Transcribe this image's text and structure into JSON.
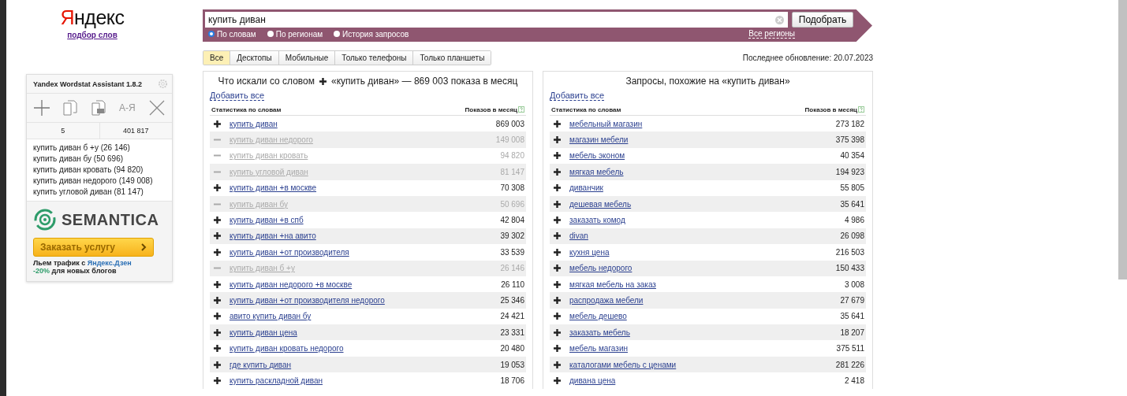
{
  "logo": {
    "text": "Яндекс",
    "subtitle": "подбор слов"
  },
  "search": {
    "value": "купить диван",
    "button": "Подобрать",
    "all_regions": "Все регионы",
    "modes": [
      {
        "label": "По словам",
        "selected": true
      },
      {
        "label": "По регионам",
        "selected": false
      },
      {
        "label": "История запросов",
        "selected": false
      }
    ]
  },
  "tabs": [
    {
      "label": "Все",
      "selected": true
    },
    {
      "label": "Десктопы",
      "selected": false
    },
    {
      "label": "Мобильные",
      "selected": false
    },
    {
      "label": "Только телефоны",
      "selected": false
    },
    {
      "label": "Только планшеты",
      "selected": false
    }
  ],
  "last_update": "Последнее обновление: 20.07.2023",
  "assistant": {
    "title": "Yandex Wordstat Assistant 1.8.2",
    "sort_label": "А-Я",
    "count": "5",
    "total": "401 817",
    "items": [
      "купить диван б +у (26 146)",
      "купить диван бу (50 696)",
      "купить диван кровать (94 820)",
      "купить диван недорого (149 008)",
      "купить угловой диван (81 147)"
    ],
    "ad": {
      "brand": "SEMANTICA",
      "button": "Заказать услугу",
      "line1": "Льем трафик с **Яндекс.Дзен**",
      "line2": "**-20%** для новых блогов"
    }
  },
  "panels": [
    {
      "title_pre": "Что искали со словом",
      "title_post": "«купить диван» — 869 003 показа в месяц",
      "add_all": "Добавить все",
      "col_words": "Статистика по словам",
      "col_count": "Показов в месяц",
      "rows": [
        {
          "phrase": "купить диван",
          "count": "869 003",
          "added": false
        },
        {
          "phrase": "купить диван недорого",
          "count": "149 008",
          "added": true
        },
        {
          "phrase": "купить диван кровать",
          "count": "94 820",
          "added": true
        },
        {
          "phrase": "купить угловой диван",
          "count": "81 147",
          "added": true
        },
        {
          "phrase": "купить диван +в москве",
          "count": "70 308",
          "added": false
        },
        {
          "phrase": "купить диван бу",
          "count": "50 696",
          "added": true
        },
        {
          "phrase": "купить диван +в спб",
          "count": "42 804",
          "added": false
        },
        {
          "phrase": "купить диван +на авито",
          "count": "39 302",
          "added": false
        },
        {
          "phrase": "купить диван +от производителя",
          "count": "33 539",
          "added": false
        },
        {
          "phrase": "купить диван б +у",
          "count": "26 146",
          "added": true
        },
        {
          "phrase": "купить диван недорого +в москве",
          "count": "26 110",
          "added": false
        },
        {
          "phrase": "купить диван +от производителя недорого",
          "count": "25 346",
          "added": false
        },
        {
          "phrase": "авито купить диван бу",
          "count": "24 421",
          "added": false
        },
        {
          "phrase": "купить диван цена",
          "count": "23 331",
          "added": false
        },
        {
          "phrase": "купить диван кровать недорого",
          "count": "20 480",
          "added": false
        },
        {
          "phrase": "где купить диван",
          "count": "19 053",
          "added": false
        },
        {
          "phrase": "купить раскладной диван",
          "count": "18 706",
          "added": false
        }
      ]
    },
    {
      "title_pre": "Запросы, похожие на «купить диван»",
      "add_all": "Добавить все",
      "col_words": "Статистика по словам",
      "col_count": "Показов в месяц",
      "rows": [
        {
          "phrase": "мебельный магазин",
          "count": "273 182",
          "added": false
        },
        {
          "phrase": "магазин мебели",
          "count": "375 398",
          "added": false
        },
        {
          "phrase": "мебель эконом",
          "count": "40 354",
          "added": false
        },
        {
          "phrase": "мягкая мебель",
          "count": "194 923",
          "added": false
        },
        {
          "phrase": "диванчик",
          "count": "55 805",
          "added": false
        },
        {
          "phrase": "дешевая мебель",
          "count": "35 641",
          "added": false
        },
        {
          "phrase": "заказать комод",
          "count": "4 986",
          "added": false
        },
        {
          "phrase": "divan",
          "count": "26 098",
          "added": false
        },
        {
          "phrase": "кухня цена",
          "count": "216 503",
          "added": false
        },
        {
          "phrase": "мебель недорого",
          "count": "150 433",
          "added": false
        },
        {
          "phrase": "мягкая мебель на заказ",
          "count": "3 008",
          "added": false
        },
        {
          "phrase": "распродажа мебели",
          "count": "27 679",
          "added": false
        },
        {
          "phrase": "мебель дешево",
          "count": "35 641",
          "added": false
        },
        {
          "phrase": "заказать мебель",
          "count": "18 207",
          "added": false
        },
        {
          "phrase": "мебель магазин",
          "count": "375 511",
          "added": false
        },
        {
          "phrase": "каталогами мебель с ценами",
          "count": "281 226",
          "added": false
        },
        {
          "phrase": "дивана цена",
          "count": "2 418",
          "added": false
        }
      ]
    }
  ]
}
